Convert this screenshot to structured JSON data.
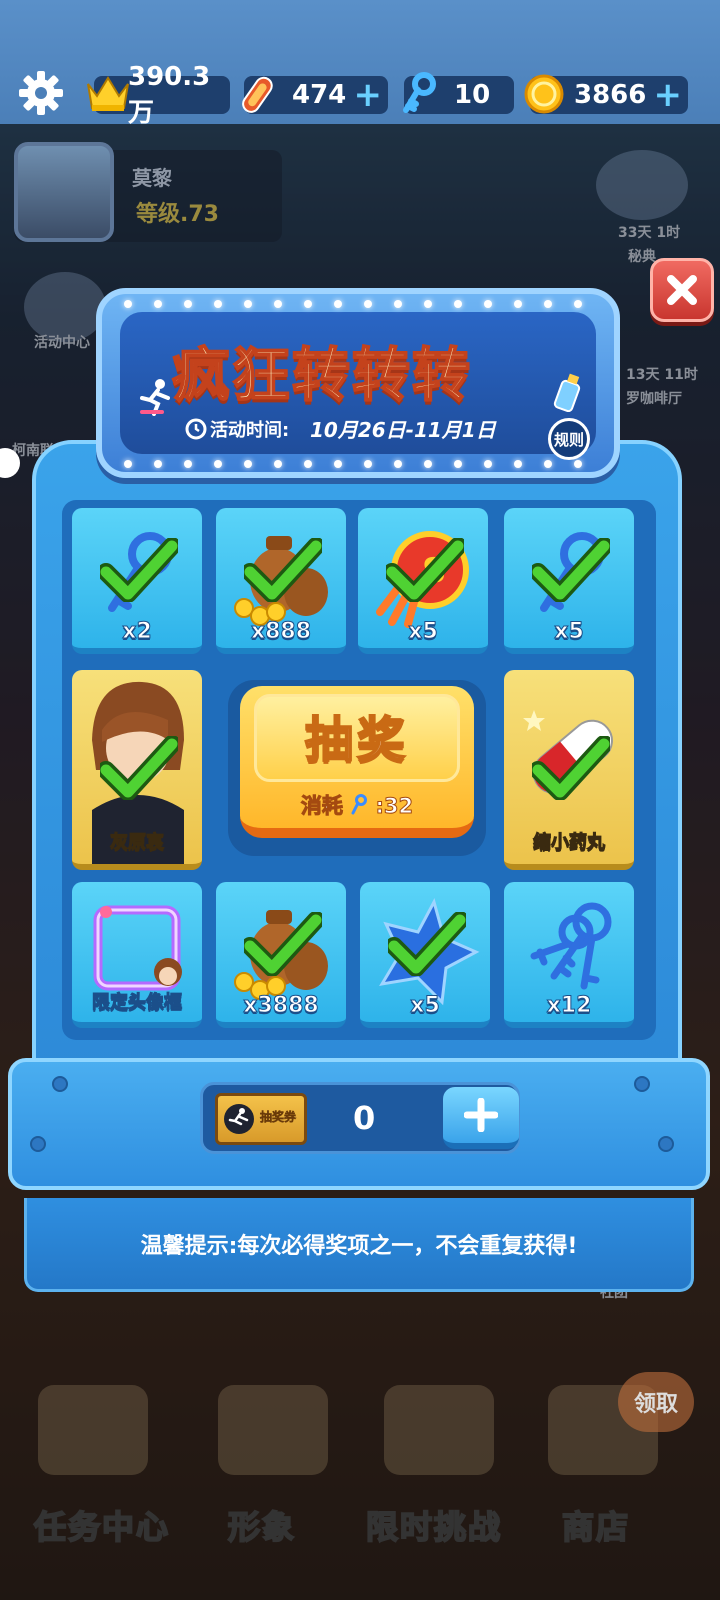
{
  "topbar": {
    "crown_value": "390.3万",
    "skateboard_value": "474",
    "key_value": "10",
    "coin_value": "3866"
  },
  "background": {
    "player_name": "莫黎",
    "player_level": "等级.73",
    "side_activity": "活动中心",
    "side_left2": "柯南联",
    "side_right_timer": "33天 1时",
    "side_right_timer2": "13天 11时",
    "side_right_label": "秘典",
    "side_right_label2": "罗咖啡厅",
    "side_right_label3": "社团",
    "bottom_nav": [
      "任务中心",
      "形象",
      "限时挑战",
      "商店"
    ],
    "bottom_badge": "领取"
  },
  "panel": {
    "title": "疯狂转转转",
    "time_label": "活动时间:",
    "time_value": "10月26日-11月1日",
    "rules_label": "规则",
    "draw_label": "抽奖",
    "draw_cost": "消耗",
    "draw_cost_value": ":32",
    "ticket_label": "抽奖券",
    "ticket_count": "0",
    "tip": "温馨提示:每次必得奖项之一，不会重复获得!"
  },
  "prizes": [
    {
      "qty": "x2",
      "icon": "key-icon",
      "claimed": true
    },
    {
      "qty": "x888",
      "icon": "coin-bag-icon",
      "claimed": true
    },
    {
      "qty": "x5",
      "icon": "rocket-badge-icon",
      "claimed": true
    },
    {
      "qty": "x5",
      "icon": "key-icon",
      "claimed": true
    },
    {
      "name": "灰原哀",
      "icon": "character-icon",
      "claimed": true
    },
    {
      "name": "缩小药丸",
      "icon": "pill-icon",
      "claimed": true
    },
    {
      "name": "限定头像框",
      "icon": "avatar-frame-icon",
      "claimed": false
    },
    {
      "qty": "x3888",
      "icon": "coin-bag-icon",
      "claimed": true
    },
    {
      "qty": "x5",
      "icon": "star-icon",
      "claimed": true
    },
    {
      "qty": "x12",
      "icon": "keys-icon",
      "claimed": false
    }
  ],
  "colors": {
    "panel_blue": "#2d8ad8",
    "cell_blue": "#3cc0f0",
    "gold": "#ffb72a",
    "check_green": "#3fc52a"
  }
}
